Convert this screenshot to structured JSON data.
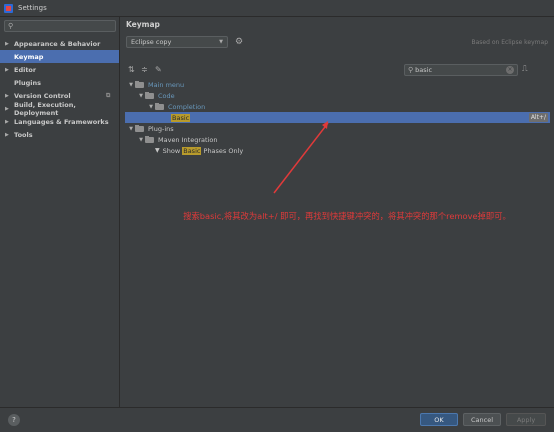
{
  "window": {
    "title": "Settings"
  },
  "search": {
    "placeholder": ""
  },
  "sidebar": {
    "items": [
      {
        "label": "Appearance & Behavior",
        "expandable": true,
        "selected": false
      },
      {
        "label": "Keymap",
        "expandable": false,
        "selected": true
      },
      {
        "label": "Editor",
        "expandable": true,
        "selected": false
      },
      {
        "label": "Plugins",
        "expandable": false,
        "selected": false
      },
      {
        "label": "Version Control",
        "expandable": true,
        "selected": false,
        "badge": "⧉"
      },
      {
        "label": "Build, Execution, Deployment",
        "expandable": true,
        "selected": false
      },
      {
        "label": "Languages & Frameworks",
        "expandable": true,
        "selected": false
      },
      {
        "label": "Tools",
        "expandable": true,
        "selected": false
      }
    ]
  },
  "keymap": {
    "title": "Keymap",
    "scheme": "Eclipse copy",
    "based_on": "Based on Eclipse keymap",
    "filter_value": "basic",
    "icons": [
      "expand-all-icon",
      "collapse-all-icon",
      "edit-icon",
      "gear-icon",
      "find-shortcut-icon"
    ]
  },
  "tree": {
    "main_menu": "Main menu",
    "code": "Code",
    "completion": "Completion",
    "basic": "Basic",
    "basic_shortcut": "Alt+/",
    "plug_ins": "Plug-ins",
    "maven_integration": "Maven Integration",
    "show_prefix": "Show ",
    "show_highlight": "Basic",
    "show_suffix": " Phases Only"
  },
  "annotation": {
    "text": "搜索basic,将其改为alt+/ 即可，再找到快捷键冲突的，将其冲突的那个remove掉即可。",
    "color": "#e03a3a"
  },
  "buttons": {
    "ok": "OK",
    "cancel": "Cancel",
    "apply": "Apply",
    "help": "?"
  },
  "colors": {
    "selection": "#4b6eaf",
    "panel": "#3c3f41",
    "highlight": "#b89b2c",
    "link_blue": "#6897bb"
  }
}
